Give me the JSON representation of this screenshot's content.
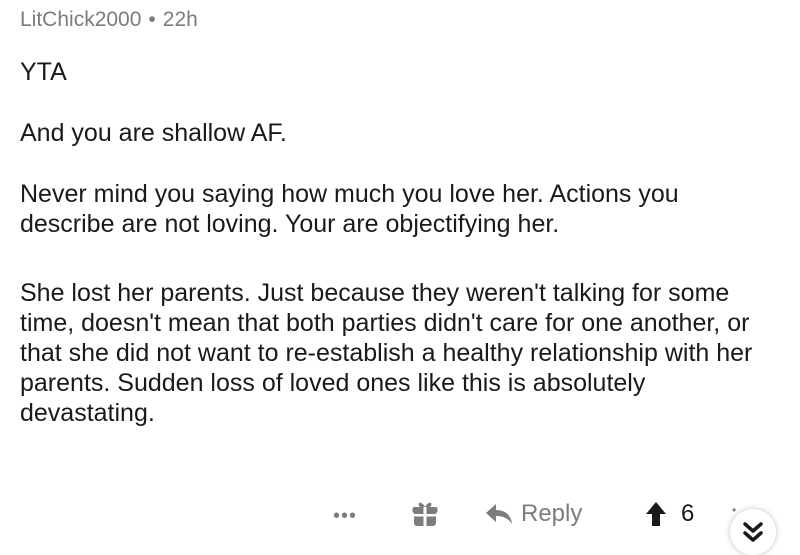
{
  "comment": {
    "author": "LitChick2000",
    "separator": "•",
    "age": "22h",
    "paragraphs": [
      "YTA",
      "And you are shallow AF.",
      "Never mind you saying how much you love her. Actions you describe are not loving. Your are objectifying her.",
      "She lost her parents. Just because they weren't talking for some time, doesn't mean that both parties didn't care for one another, or that she did not want to re-establish a healthy relationship with her parents. Sudden loss of loved ones like this is absolutely devastating."
    ]
  },
  "actions": {
    "more_label": "•••",
    "reply_label": "Reply",
    "vote_count": "6",
    "tiny_dot": "•"
  },
  "icons": {
    "gift": "gift-icon",
    "reply": "reply-arrow-icon",
    "upvote": "upvote-arrow-icon",
    "collapse": "double-chevron-down-icon"
  }
}
